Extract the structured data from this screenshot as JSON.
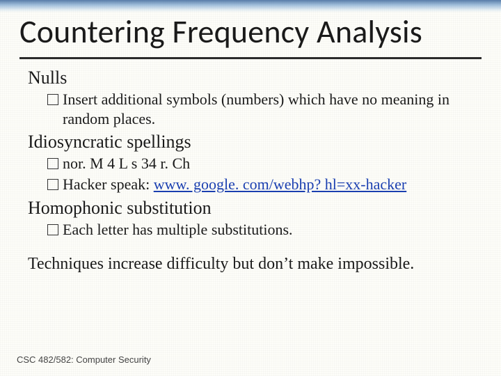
{
  "title": "Countering Frequency Analysis",
  "sections": {
    "nulls": {
      "heading": "Nulls",
      "items": [
        {
          "text": "Insert additional symbols (numbers) which have no meaning in random places."
        }
      ]
    },
    "idiosyncratic": {
      "heading": "Idiosyncratic spellings",
      "items": [
        {
          "text": "nor. M 4 L s 34 r. Ch"
        },
        {
          "prefix": "Hacker speak: ",
          "link": "www. google. com/webhp? hl=xx-hacker"
        }
      ]
    },
    "homophonic": {
      "heading": "Homophonic substitution",
      "items": [
        {
          "text": "Each letter has multiple substitutions."
        }
      ]
    }
  },
  "summary": "Techniques increase difficulty but don’t make impossible.",
  "footer": "CSC 482/582: Computer Security"
}
